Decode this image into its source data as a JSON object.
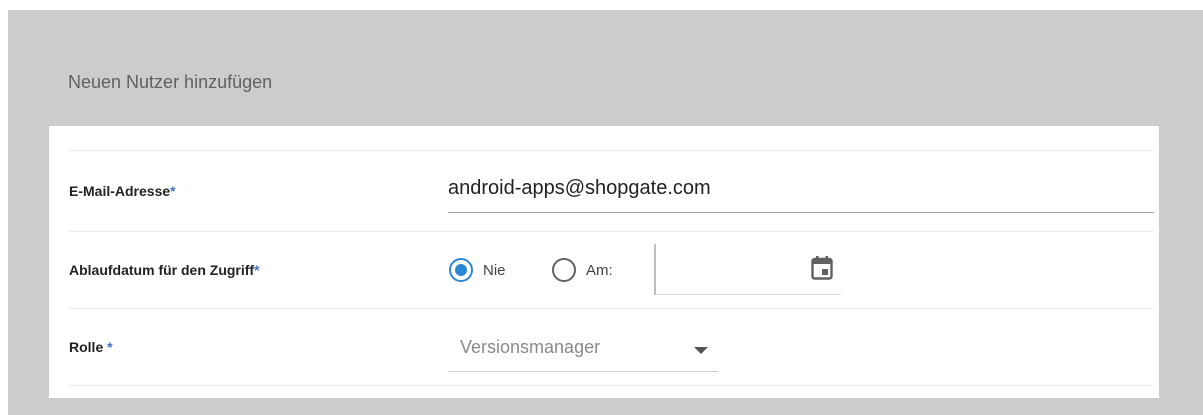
{
  "dialog": {
    "title": "Neuen Nutzer hinzufügen"
  },
  "form": {
    "email": {
      "label": "E-Mail-Adresse",
      "required_mark": "*",
      "value": "android-apps@shopgate.com"
    },
    "expiry": {
      "label": "Ablaufdatum für den Zugriff",
      "required_mark": "*",
      "option_never": "Nie",
      "option_on": "Am:",
      "selected": "Nie",
      "date_value": "",
      "icon": "calendar-icon"
    },
    "role": {
      "label": "Rolle",
      "required_mark": " *",
      "selected": "Versionsmanager",
      "icon": "caret-down-icon"
    }
  },
  "colors": {
    "accent": "#2b87d3",
    "required": "#3f73c1",
    "overlay": "#cccccc"
  }
}
